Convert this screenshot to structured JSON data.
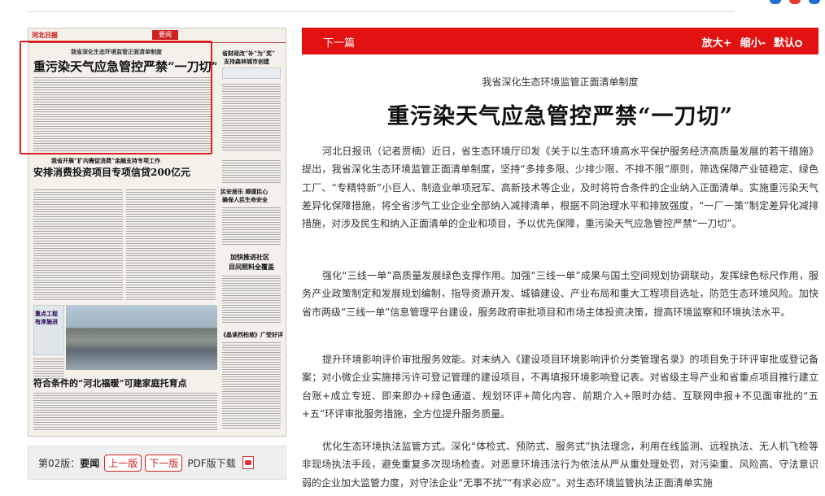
{
  "top_icon_colors": [
    "#1e6fd1",
    "#e23b2c",
    "#1e6fd1"
  ],
  "thumbnail": {
    "logo": "河北日报",
    "section_tag": "要闻",
    "headlines": [
      {
        "text": "我省深化生态环境监管正面清单制度"
      },
      {
        "text": "重污染天气应急管控严禁“一刀切”"
      },
      {
        "text": "省财政改“补”为“奖”"
      },
      {
        "text": "支持森林城市创建"
      },
      {
        "text": "我省开展“扩内需促消费”金融支持专项工作"
      },
      {
        "text": "安排消费投资项目专项信贷200亿元"
      },
      {
        "text": "民安居乐 顺德民心"
      },
      {
        "text": "确保人民生命安全"
      },
      {
        "text": "加快推进社区"
      },
      {
        "text": "目间照料全覆盖"
      },
      {
        "text": "重点工程"
      },
      {
        "text": "有序施进"
      },
      {
        "text": "《晶读西柏坡》广受好评"
      },
      {
        "text": "符合条件的“河北福暖”可建家庭托育点"
      }
    ]
  },
  "page_nav": {
    "page_label": "第02版：",
    "page_name": "要闻",
    "prev": "上一版",
    "next": "下一版",
    "pdf": "PDF版下载"
  },
  "article_bar": {
    "next_article": "下一篇",
    "zoom_in": "放大+",
    "zoom_out": "缩小-",
    "default": "默认"
  },
  "article": {
    "subtitle": "我省深化生态环境监管正面清单制度",
    "title": "重污染天气应急管控严禁“一刀切”",
    "paragraphs": [
      "河北日报讯（记者贾楠）近日，省生态环境厅印发《关于以生态环境高水平保护服务经济高质量发展的若干措施》提出，我省深化生态环境监管正面清单制度，坚持“多排多限、少排少限、不排不限”原则，筛选保障产业链稳定、绿色工厂、“专精特新”小巨人、制造业单项冠军、高新技术等企业，及时将符合条件的企业纳入正面清单。实施重污染天气差异化保障措施，将全省涉气工业企业全部纳入减排清单，根据不同治理水平和排放强度，“一厂一策”制定差异化减排措施，对涉及民生和纳入正面清单的企业和项目，予以优先保障，重污染天气应急管控严禁“一刀切”。",
      "强化“三线一单”高质量发展绿色支撑作用。加强“三线一单”成果与国土空间规划协调联动，发挥绿色标尺作用，服务产业政策制定和发展规划编制，指导资源开发、城镇建设、产业布局和重大工程项目选址，防范生态环境风险。加快省市两级“三线一单”信息管理平台建设，服务政府审批项目和市场主体投资决策，提高环境监察和环境执法水平。",
      "提升环境影响评价审批服务效能。对未纳入《建设项目环境影响评价分类管理名录》的项目免于环评审批或登记备案；对小微企业实施排污许可登记管理的建设项目，不再填报环境影响登记表。对省级主导产业和省重点项目推行建立台账+成立专班、即来即办+绿色通道、规划环评+简化内容、前期介入+限时办结、互联网申报+不见面审批的“五+五”环评审批服务措施，全方位提升服务质量。",
      "优化生态环境执法监管方式。深化“体检式、预防式、服务式”执法理念，利用在线监测、远程执法、无人机飞检等非现场执法手段，避免重复多次现场检查。对恶意环境违法行为依法从严从重处理处罚，对污染重、风险高、守法意识弱的企业加大监管力度，对守法企业“无事不扰”“有求必应”。对生态环境监管执法正面清单实施"
    ]
  }
}
